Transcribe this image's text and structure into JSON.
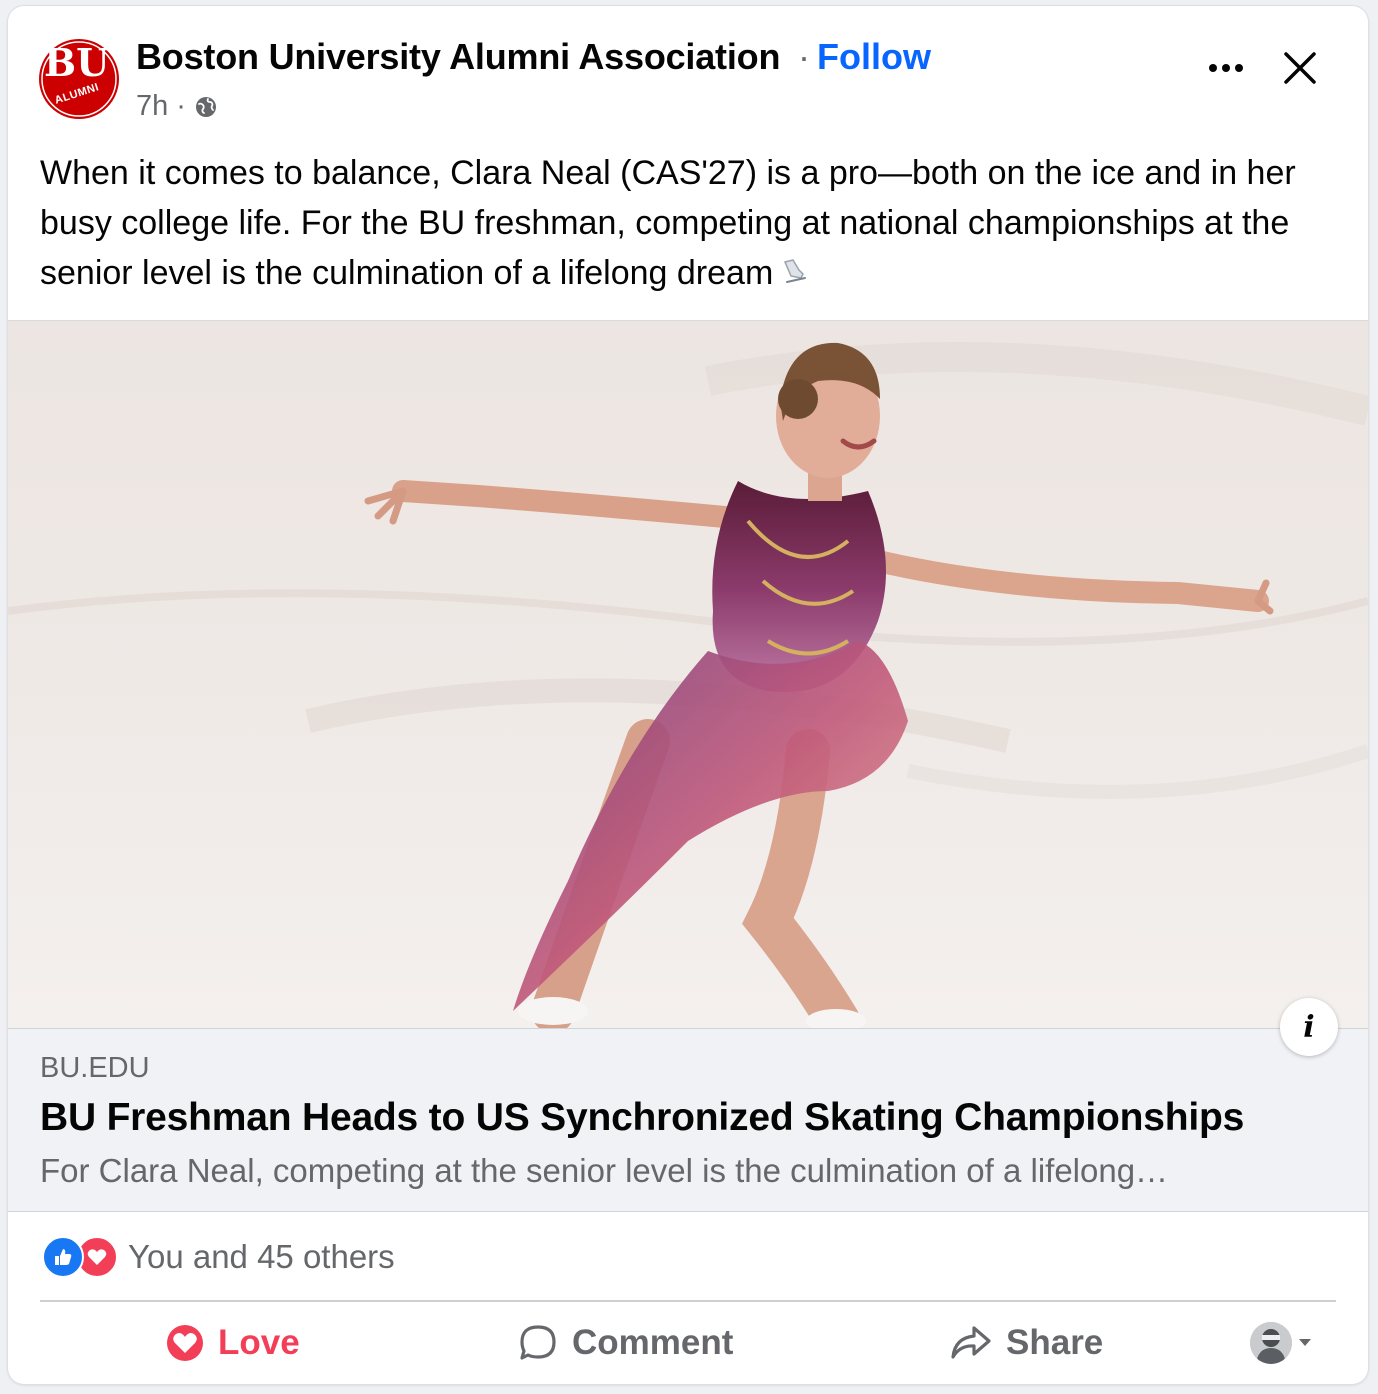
{
  "post": {
    "page_name": "Boston University Alumni Association",
    "separator": "·",
    "follow_label": "Follow",
    "time": "7h",
    "time_separator": "·",
    "avatar_logo_text": "BU",
    "avatar_logo_subtext": "ALUMNI",
    "text": "When it comes to balance, Clara Neal (CAS'27) is a pro—both on the ice and in her busy college life. For the BU freshman, competing at national championships at the senior level is the culmination of a lifelong dream",
    "text_emoji": "ice-skate-icon"
  },
  "link_preview": {
    "domain": "BU.EDU",
    "title": "BU Freshman Heads to US Synchronized Skating Championships",
    "description": "For Clara Neal, competing at the senior level is the culmination of a lifelong…",
    "info_label": "i"
  },
  "reactions": {
    "summary": "You and 45 others",
    "icons": [
      "like-icon",
      "love-icon"
    ]
  },
  "actions": {
    "love_label": "Love",
    "comment_label": "Comment",
    "share_label": "Share"
  },
  "colors": {
    "brand_blue": "#0866ff",
    "love_red": "#f33e58",
    "secondary_text": "#65676b",
    "bu_red": "#cc0000"
  }
}
